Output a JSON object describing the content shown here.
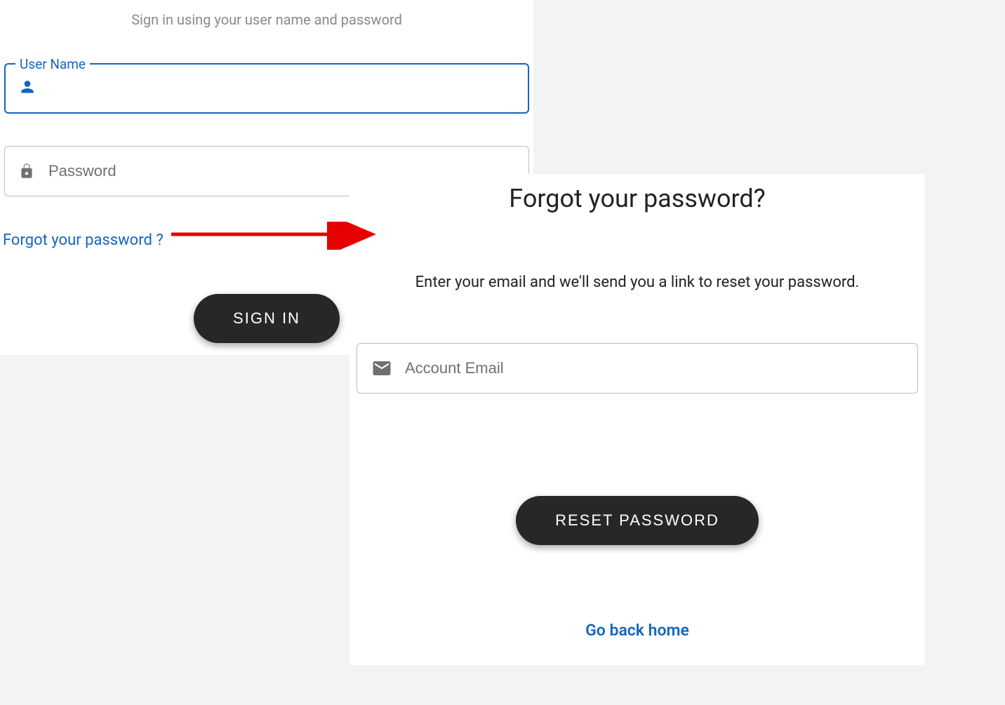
{
  "signin": {
    "subtitle": "Sign in using your user name and password",
    "username_label": "User Name",
    "username_value": "",
    "password_placeholder": "Password",
    "password_value": "",
    "forgot_link": "Forgot your password ?",
    "submit_label": "SIGN IN"
  },
  "forgot": {
    "title": "Forgot your password?",
    "description": "Enter your email and we'll send you a link to reset your password.",
    "email_placeholder": "Account Email",
    "email_value": "",
    "submit_label": "RESET PASSWORD",
    "home_link": "Go back home"
  },
  "annotation": {
    "arrow_color": "#e60000"
  }
}
